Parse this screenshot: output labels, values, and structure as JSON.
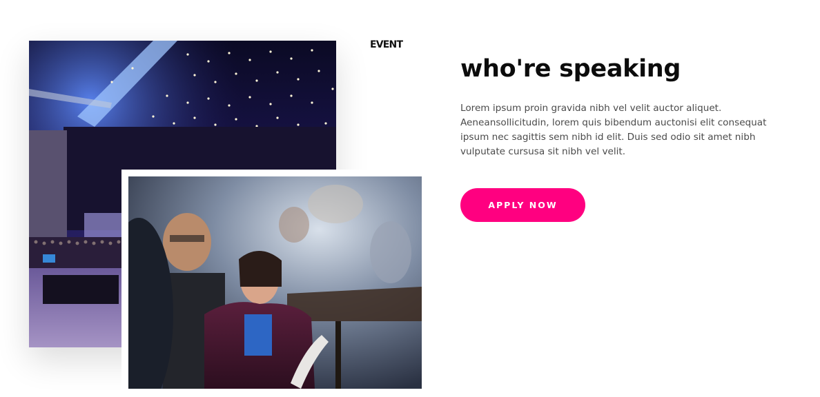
{
  "section": {
    "tag": "EVENT",
    "headline": "who're speaking",
    "body": "Lorem ipsum proin gravida nibh vel velit auctor aliquet. Aeneansollicitudin, lorem quis bibendum auctonisi elit consequat ipsum nec sagittis sem nibh id elit. Duis sed odio sit amet nibh vulputate cursusa sit nibh vel velit.",
    "cta_label": "APPLY NOW"
  },
  "images": {
    "back": "conference-hall-photo",
    "front": "audience-attendee-photo"
  },
  "colors": {
    "accent": "#ff0080",
    "heading": "#0c0c0c",
    "body": "#4a4a4a"
  }
}
